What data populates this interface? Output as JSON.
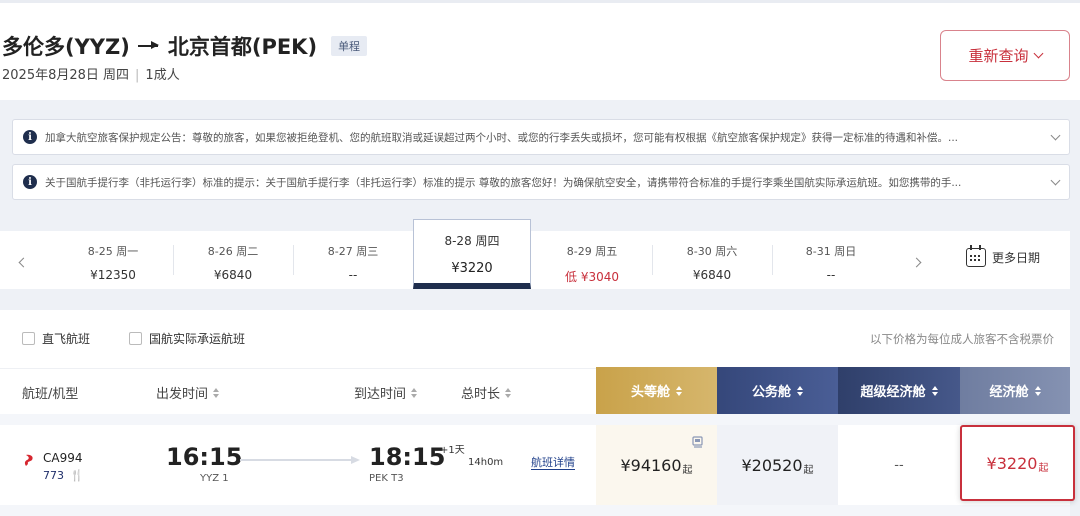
{
  "header": {
    "origin": "多伦多(YYZ)",
    "destination": "北京首都(PEK)",
    "trip_type": "单程",
    "date": "2025年8月28日 周四",
    "passengers": "1成人",
    "requery_label": "重新查询"
  },
  "notices": [
    {
      "text": "加拿大航空旅客保护规定公告：尊敬的旅客，如果您被拒绝登机、您的航班取消或延误超过两个小时、或您的行李丢失或损坏，您可能有权根据《航空旅客保护规定》获得一定标准的待遇和补偿。..."
    },
    {
      "text": "关于国航手提行李（非托运行李）标准的提示：关于国航手提行李（非托运行李）标准的提示 尊敬的旅客您好！为确保航空安全，请携带符合标准的手提行李乘坐国航实际承运航班。如您携带的手..."
    }
  ],
  "date_bar": {
    "dates": [
      {
        "date": "8-25 周一",
        "price": "¥12350",
        "low": false
      },
      {
        "date": "8-26 周二",
        "price": "¥6840",
        "low": false
      },
      {
        "date": "8-27 周三",
        "price": "--",
        "low": false
      },
      {
        "date": "8-28 周四",
        "price": "¥3220",
        "low": false,
        "selected": true
      },
      {
        "date": "8-29 周五",
        "price": "低 ¥3040",
        "low": true
      },
      {
        "date": "8-30 周六",
        "price": "¥6840",
        "low": false
      },
      {
        "date": "8-31 周日",
        "price": "--",
        "low": false
      }
    ],
    "more_dates_label": "更多日期"
  },
  "filters": {
    "direct_label": "直飞航班",
    "ca_operated_label": "国航实际承运航班",
    "tax_note": "以下价格为每位成人旅客不含税票价"
  },
  "columns": {
    "flight": "航班/机型",
    "departure": "出发时间",
    "arrival": "到达时间",
    "duration": "总时长",
    "first": "头等舱",
    "business": "公务舱",
    "premium": "超级经济舱",
    "economy": "经济舱"
  },
  "flight": {
    "number": "CA994",
    "aircraft": "773",
    "dep_time": "16:15",
    "dep_airport": "YYZ 1",
    "arr_time": "18:15",
    "plus_day": "+1天",
    "arr_airport": "PEK T3",
    "duration": "14h0m",
    "details_label": "航班详情",
    "prices": {
      "first": "¥94160",
      "business": "¥20520",
      "premium": "--",
      "economy": "¥3220"
    },
    "price_suffix": "起"
  },
  "colors": {
    "accent_red": "#c8303c",
    "navy": "#1f2e4d",
    "first_gold": "#c9a24a"
  }
}
